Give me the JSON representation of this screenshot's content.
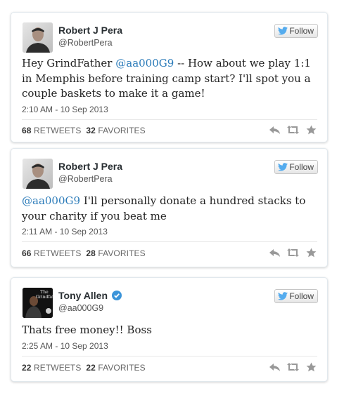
{
  "follow_label": "Follow",
  "tweets": [
    {
      "name": "Robert J Pera",
      "handle": "@RobertPera",
      "text_lines": [
        "Hey GrindFather ",
        "@aa000G9",
        " -- How about we play 1:1 in Memphis before training camp start?  I'll spot you a couple baskets to make it a game!"
      ],
      "time": "2:10 AM - 10 Sep 2013",
      "retweets_count": "68",
      "retweets_label": "RETWEETS",
      "favorites_count": "32",
      "favorites_label": "FAVORITES"
    },
    {
      "name": "Robert J Pera",
      "handle": "@RobertPera",
      "text_lines": [
        "",
        "@aa000G9",
        " I'll personally donate a hundred stacks to your charity if you beat me"
      ],
      "time": "2:11 AM - 10 Sep 2013",
      "retweets_count": "66",
      "retweets_label": "RETWEETS",
      "favorites_count": "28",
      "favorites_label": "FAVORITES"
    },
    {
      "name": "Tony Allen",
      "handle": "@aa000G9",
      "text_lines": [
        "Thats free money!! Boss",
        "",
        ""
      ],
      "time": "2:25 AM - 10 Sep 2013",
      "retweets_count": "22",
      "retweets_label": "RETWEETS",
      "favorites_count": "22",
      "favorites_label": "FAVORITES",
      "avatar_text": "The Grindfather"
    }
  ],
  "colors": {
    "mention": "#2b7bb9",
    "verified": "#3b94d9",
    "twitter_bird": "#55acee",
    "action_icons": "#999999"
  },
  "icons": [
    "twitter-bird-icon",
    "verified-badge-icon",
    "reply-icon",
    "retweet-icon",
    "favorite-star-icon"
  ]
}
